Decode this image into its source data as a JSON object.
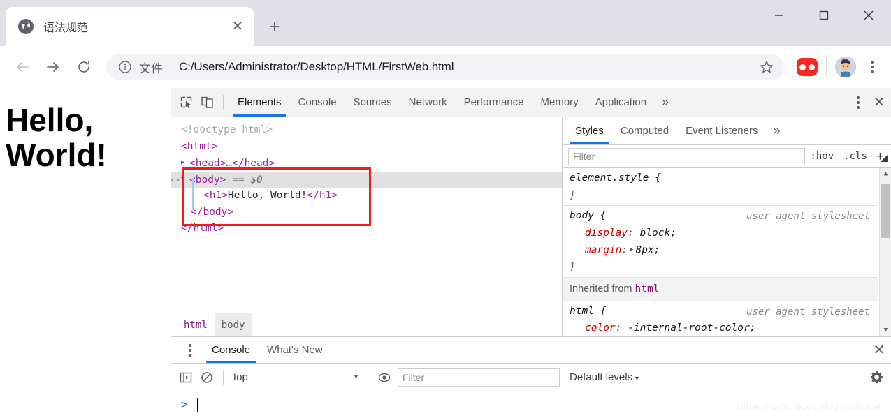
{
  "browser": {
    "tab": {
      "title": "语法规范",
      "favicon": "globe-icon",
      "close": "✕"
    },
    "new_tab": "+",
    "window_controls": {
      "minimize": "—",
      "maximize": "□",
      "close": "✕"
    },
    "nav": {
      "back": "←",
      "forward": "→",
      "reload": "⟳"
    },
    "omnibox": {
      "info_icon": "info-circle-icon",
      "scheme_label": "文件",
      "url": "C:/Users/Administrator/Desktop/HTML/FirstWeb.html",
      "bookmark_icon": "star-icon"
    },
    "extension_icon": "extension-icon",
    "avatar": "profile-avatar",
    "menu": "kebab-menu-icon"
  },
  "page": {
    "heading": "Hello, World!"
  },
  "devtools": {
    "toolbar": {
      "inspect_icon": "inspect-element-icon",
      "device_icon": "device-toolbar-icon",
      "tabs": [
        {
          "label": "Elements",
          "active": true
        },
        {
          "label": "Console",
          "active": false
        },
        {
          "label": "Sources",
          "active": false
        },
        {
          "label": "Network",
          "active": false
        },
        {
          "label": "Performance",
          "active": false
        },
        {
          "label": "Memory",
          "active": false
        },
        {
          "label": "Application",
          "active": false
        }
      ],
      "overflow": "»",
      "more_options": "kebab-menu-icon",
      "close": "✕"
    },
    "dom_tree": {
      "lines": [
        {
          "type": "doctype",
          "text": "<!doctype html>"
        },
        {
          "type": "open",
          "text": "<html>"
        },
        {
          "type": "collapsed",
          "arrow": "▶",
          "text": "<head>…</head>"
        },
        {
          "type": "selected",
          "arrow": "▼",
          "tag": "<body>",
          "suffix": "== $0"
        },
        {
          "type": "child",
          "text": "<h1>Hello, World!</h1>"
        },
        {
          "type": "close",
          "text": "</body>"
        },
        {
          "type": "close",
          "text": "</html>"
        }
      ]
    },
    "breadcrumb": [
      {
        "label": "html",
        "current": false
      },
      {
        "label": "body",
        "current": true
      }
    ],
    "styles": {
      "tabs": [
        {
          "label": "Styles",
          "active": true
        },
        {
          "label": "Computed",
          "active": false
        },
        {
          "label": "Event Listeners",
          "active": false
        }
      ],
      "overflow": "»",
      "filter_placeholder": "Filter",
      "hov_label": ":hov",
      "cls_label": ".cls",
      "new_rule": "+",
      "rules": [
        {
          "selector": "element.style {",
          "origin": "",
          "declarations": [],
          "close": "}"
        },
        {
          "selector": "body {",
          "origin": "user agent stylesheet",
          "declarations": [
            {
              "name": "display",
              "value": "block;",
              "expandable": false
            },
            {
              "name": "margin",
              "value": "8px;",
              "expandable": true
            }
          ],
          "close": "}"
        }
      ],
      "inherited_label": "Inherited from",
      "inherited_from": "html",
      "inherited_rule": {
        "selector": "html {",
        "origin": "user agent stylesheet",
        "declarations": [
          {
            "name": "color",
            "value": "-internal-root-color;",
            "expandable": false
          }
        ]
      }
    },
    "drawer": {
      "more_options": "kebab-menu-icon",
      "tabs": [
        {
          "label": "Console",
          "active": true
        },
        {
          "label": "What's New",
          "active": false
        }
      ],
      "close": "✕",
      "console_toolbar": {
        "sidebar_icon": "console-sidebar-icon",
        "clear_icon": "clear-console-icon",
        "context": "top",
        "context_caret": "▾",
        "eye_icon": "live-expression-icon",
        "filter_placeholder": "Filter",
        "levels_label": "Default levels",
        "levels_caret": "▾",
        "settings_icon": "gear-icon"
      },
      "prompt": ">"
    }
  },
  "watermark": "https://sanshisan.blog.csdn.net",
  "colors": {
    "chrome_tabstrip": "#dee1e6",
    "accent_blue": "#1a73e8",
    "tag_purple": "#881280",
    "annotation_red": "#e8201a",
    "prop_red": "#c80000"
  }
}
